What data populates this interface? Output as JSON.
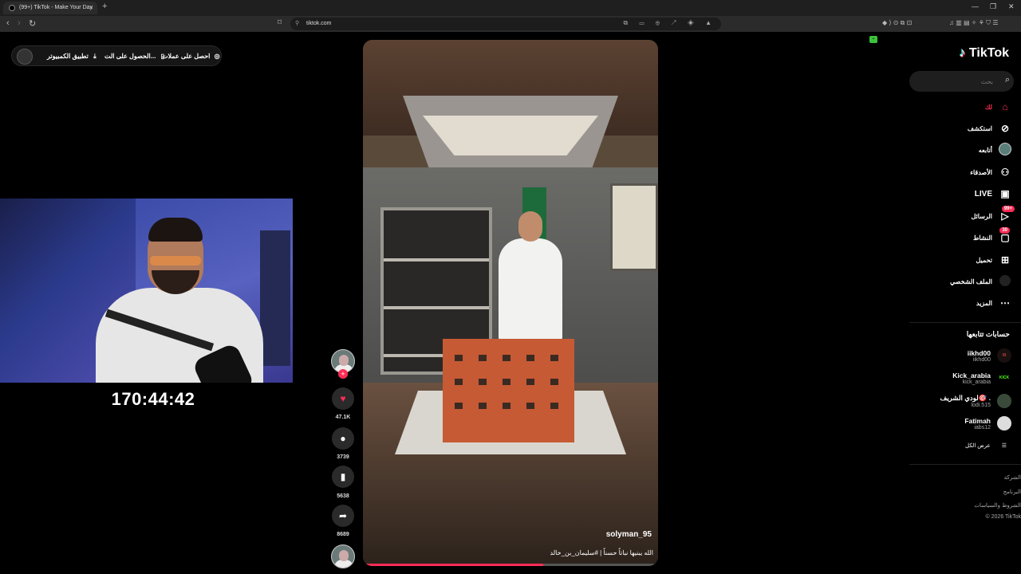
{
  "browser": {
    "tab_title": "(99+) TikTok - Make Your Day",
    "tab_close": "×",
    "new_tab": "+",
    "url": "tiktok.com",
    "window_controls": [
      "—",
      "❐",
      "✕"
    ]
  },
  "top_pill": {
    "coins_label": "احصل على عملات",
    "app_label": "الحصول على الت...",
    "desktop_label": "تطبيق الكمبيوتر"
  },
  "stream_timer": "170:44:42",
  "video": {
    "author": "solyman_95",
    "caption": "الله يبنيها نباتاً حسناً | #سليمان_بن_خالد",
    "progress": 0.61
  },
  "actions": {
    "likes": "47.1K",
    "comments": "3739",
    "saves": "5638",
    "shares": "8689"
  },
  "sidebar": {
    "logo": "TikTok",
    "search_placeholder": "بحث",
    "nav": [
      {
        "label": "لك",
        "icon": "home-icon"
      },
      {
        "label": "استكشف",
        "icon": "compass-icon"
      },
      {
        "label": "أتابعه",
        "icon": "following-avatar-icon"
      },
      {
        "label": "الأصدقاء",
        "icon": "friends-icon"
      },
      {
        "label": "LIVE",
        "icon": "live-icon"
      },
      {
        "label": "الرسائل",
        "icon": "messages-icon",
        "badge": "99+"
      },
      {
        "label": "النشاط",
        "icon": "activity-icon",
        "badge": "30"
      },
      {
        "label": "تحميل",
        "icon": "upload-icon"
      },
      {
        "label": "الملف الشخصي",
        "icon": "profile-icon"
      },
      {
        "label": "المزيد",
        "icon": "more-icon"
      }
    ],
    "following_title": "حسابات تتابعها",
    "following": [
      {
        "name": "iikhd00",
        "user": "iikhd00",
        "avatar": "XI"
      },
      {
        "name": "Kick_arabia",
        "user": "kick_arabia",
        "avatar": "KICK"
      },
      {
        "name": "لودي الشريف🎯 .",
        "user": "lodi.515",
        "avatar": ""
      },
      {
        "name": "Fatimah",
        "user": "iabs12",
        "avatar": ""
      }
    ],
    "see_all": "عرض الكل",
    "footer": [
      "الشركة",
      "البرنامج",
      "الشروط والسياسات",
      "© 2026 TikTok"
    ]
  },
  "colors": {
    "accent": "#fe2c55",
    "background": "#000000"
  }
}
